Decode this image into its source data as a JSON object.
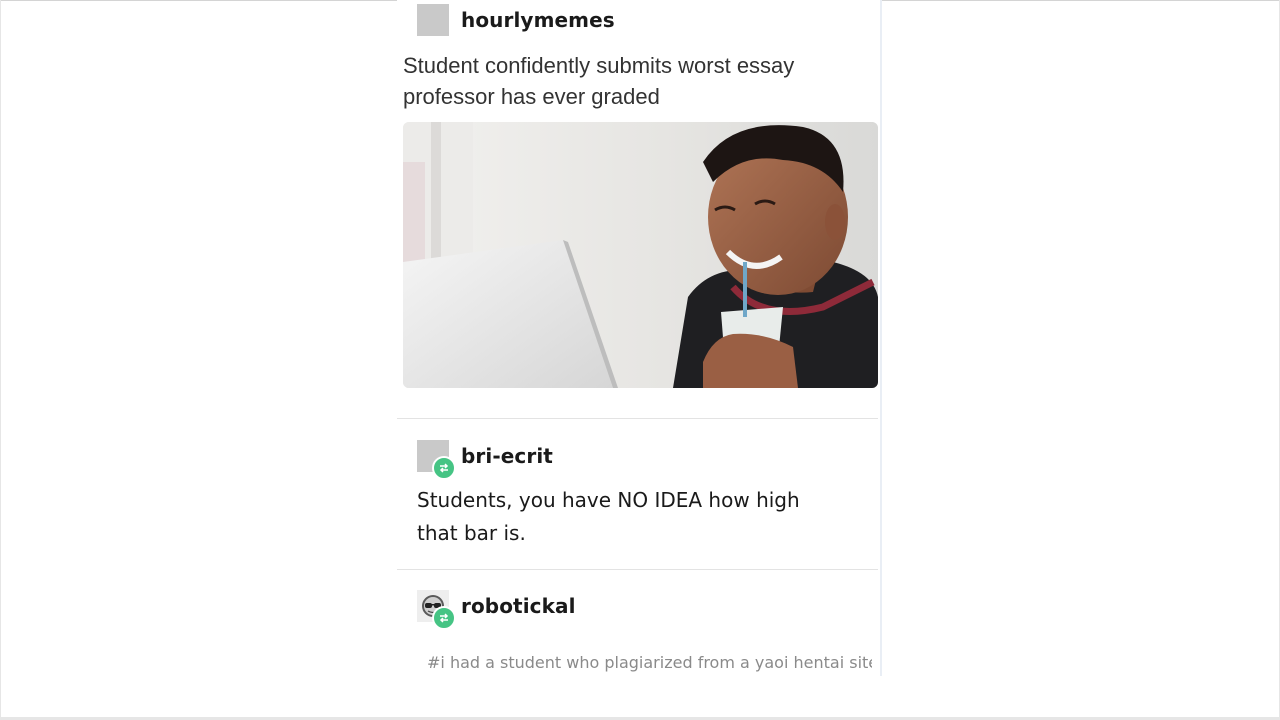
{
  "posts": {
    "original": {
      "username": "hourlymemes",
      "title_line1": "Student confidently submits worst essay",
      "title_line2": "professor has ever graded",
      "image_icon": "photo-student-laptop"
    },
    "reblog1": {
      "username": "bri-ecrit",
      "body_line1": "Students, you have NO IDEA how high",
      "body_line2": "that bar is.",
      "badge_icon": "reblog-icon"
    },
    "reblog2": {
      "username": "robotickal",
      "tags": "#i had a student who plagiarized from a yaoi hentai site",
      "avatar_icon": "sunglasses-face-icon",
      "badge_icon": "reblog-icon"
    }
  },
  "colors": {
    "reblog_badge": "#46c484",
    "avatar_placeholder": "#c9c9c9",
    "tag_text": "#8a8a8a"
  }
}
